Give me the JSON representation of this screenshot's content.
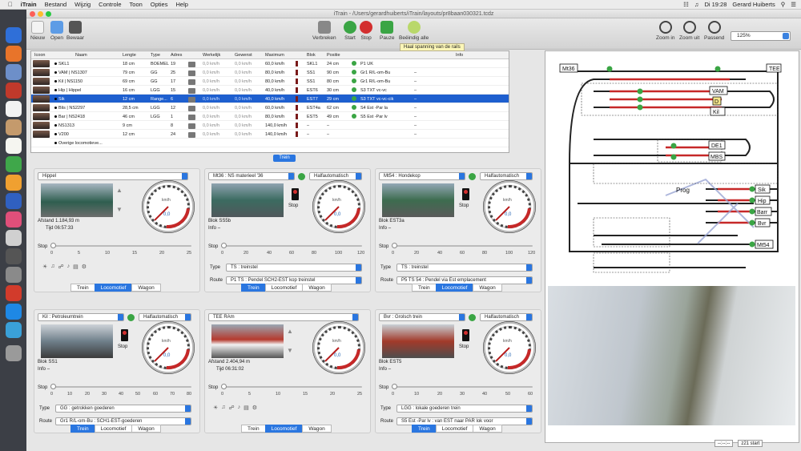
{
  "menubar": {
    "app": "iTrain",
    "items": [
      "Bestand",
      "Wijzig",
      "Controle",
      "Toon",
      "Opties",
      "Help"
    ],
    "clock": "Di 19:28",
    "user": "Gerard Huiberts"
  },
  "window": {
    "title": "iTrain - /Users/gerardhuiberts/iTrain/layouts/pr8baan030321.tcdz"
  },
  "toolbar": {
    "nieuw": "Nieuw",
    "open": "Open",
    "bewaar": "Bewaar",
    "verbreken": "Verbreken",
    "start": "Start",
    "stop": "Stop",
    "pauze": "Pauze",
    "beeindig": "Beëindig alle",
    "zoom_in": "Zoom in",
    "zoom_out": "Zoom uit",
    "passend": "Passend",
    "zoom_value": "125%",
    "tooltip": "Haal spanning van de rails"
  },
  "table": {
    "headers": [
      "Icoon",
      "Naam",
      "Lengte",
      "Type",
      "Adres",
      "Werkelijk",
      "Gewenst",
      "Maximum",
      "Blok",
      "Positie",
      "Info"
    ],
    "rows": [
      {
        "name": "SKL1",
        "length": "18 cm",
        "type": "BOEMEL",
        "addr": "19",
        "werk": "0,0 km/h",
        "gew": "0,0 km/h",
        "max": "60,0 km/h",
        "blok": "SKL1",
        "pos": "24 cm",
        "route": "P1 UK",
        "info": "",
        "sel": false
      },
      {
        "name": "VAM | NS1307",
        "length": "79 cm",
        "type": "GG",
        "addr": "25",
        "werk": "0,0 km/h",
        "gew": "0,0 km/h",
        "max": "80,0 km/h",
        "blok": "SS1",
        "pos": "90 cm",
        "route": "Gr1 R/L-om-Bu",
        "info": "–",
        "sel": false
      },
      {
        "name": "Kil | NS1150",
        "length": "69 cm",
        "type": "GG",
        "addr": "17",
        "werk": "0,0 km/h",
        "gew": "0,0 km/h",
        "max": "80,0 km/h",
        "blok": "SS1",
        "pos": "80 cm",
        "route": "Gr1 R/L-om-Bu",
        "info": "–",
        "sel": false
      },
      {
        "name": "Hip | Hippel",
        "length": "16 cm",
        "type": "LGG",
        "addr": "15",
        "werk": "0,0 km/h",
        "gew": "0,0 km/h",
        "max": "40,0 km/h",
        "blok": "EST6",
        "pos": "30 cm",
        "route": "S3 TXT vc-vc",
        "info": "–",
        "sel": false
      },
      {
        "name": "Sik",
        "length": "12 cm",
        "type": "Range...",
        "addr": "6",
        "werk": "0,0 km/h",
        "gew": "0,0 km/h",
        "max": "40,0 km/h",
        "blok": "EST7",
        "pos": "29 cm",
        "route": "S3 TXT vc-vc-cik",
        "info": "–",
        "sel": true
      },
      {
        "name": "Blis | NS2297",
        "length": "28,5 cm",
        "type": "LGG",
        "addr": "12",
        "werk": "0,0 km/h",
        "gew": "0,0 km/h",
        "max": "60,0 km/h",
        "blok": "EST4a",
        "pos": "62 cm",
        "route": "S4 Est -Par la",
        "info": "–",
        "sel": false
      },
      {
        "name": "Bar | NS2418",
        "length": "46 cm",
        "type": "LGG",
        "addr": "1",
        "werk": "0,0 km/h",
        "gew": "0,0 km/h",
        "max": "80,0 km/h",
        "blok": "EST5",
        "pos": "49 cm",
        "route": "S5 Est -Par lv",
        "info": "–",
        "sel": false
      },
      {
        "name": "NS1313",
        "length": "9 cm",
        "type": "",
        "addr": "8",
        "werk": "0,0 km/h",
        "gew": "0,0 km/h",
        "max": "140,0 km/h",
        "blok": "–",
        "pos": "–",
        "route": "",
        "info": "–",
        "sel": false
      },
      {
        "name": "V200",
        "length": "12 cm",
        "type": "",
        "addr": "24",
        "werk": "0,0 km/h",
        "gew": "0,0 km/h",
        "max": "140,0 km/h",
        "blok": "–",
        "pos": "–",
        "route": "",
        "info": "–",
        "sel": false
      },
      {
        "name": "Overige locomotieve...",
        "length": "",
        "type": "",
        "addr": "",
        "werk": "",
        "gew": "",
        "max": "",
        "blok": "",
        "pos": "",
        "route": "",
        "info": "",
        "sel": false
      }
    ]
  },
  "trein_tab": "Trein",
  "panels": [
    {
      "title": "Hippel",
      "mode": "",
      "afstand_label": "Afstand",
      "afstand": "1.184,93 m",
      "tijd_label": "Tijd",
      "tijd": "06:57:33",
      "blok": "",
      "info": "",
      "stop": "Stop",
      "scale": [
        "0",
        "5",
        "10",
        "15",
        "20",
        "25"
      ],
      "type": "",
      "route": "",
      "gauge_val": "0,0",
      "tabs": [
        "Trein",
        "Locomotief",
        "Wagon"
      ],
      "active": 1,
      "kmh": "km/h"
    },
    {
      "title": "Mt36 : NS materieel '36",
      "mode": "Halfautomatisch",
      "blok_label": "Blok",
      "blok": "SS5b",
      "info_label": "Info",
      "info": "–",
      "stop": "Stop",
      "scale": [
        "0",
        "20",
        "40",
        "60",
        "80",
        "100",
        "120"
      ],
      "type_label": "Type",
      "type": "TS : treinstel",
      "route_label": "Route",
      "route": "P1 TS : Pendel SCH2-EST kop treinstel",
      "gauge_val": "0,0",
      "tabs": [
        "Trein",
        "Locomotief",
        "Wagon"
      ],
      "active": 0,
      "kmh": "km/h"
    },
    {
      "title": "Mt54 : Hondekop",
      "mode": "Halfautomatisch",
      "blok_label": "Blok",
      "blok": "EST3a",
      "info_label": "Info",
      "info": "–",
      "stop": "Stop",
      "scale": [
        "0",
        "20",
        "40",
        "60",
        "80",
        "100",
        "120"
      ],
      "type_label": "Type",
      "type": "TS : treinstel",
      "route_label": "Route",
      "route": "P5 TS 54 : Pendel via Est emplacement",
      "gauge_val": "0,0",
      "tabs": [
        "Trein",
        "Locomotief",
        "Wagon"
      ],
      "active": 1,
      "kmh": "km/h"
    },
    {
      "title": "Kil : Petroleumtrein",
      "mode": "Halfautomatisch",
      "blok_label": "Blok",
      "blok": "SS1",
      "info_label": "Info",
      "info": "–",
      "stop": "Stop",
      "scale": [
        "0",
        "10",
        "20",
        "30",
        "40",
        "50",
        "60",
        "70",
        "80"
      ],
      "type_label": "Type",
      "type": "GG : getrokken goederen",
      "route_label": "Route",
      "route": "Gr1 R/L-om-Bu : SCH1-EST-goederen",
      "gauge_val": "0,0",
      "tabs": [
        "Trein",
        "Locomotief",
        "Wagon"
      ],
      "active": 0,
      "kmh": "km/h"
    },
    {
      "title": "TEE RAm",
      "mode": "",
      "afstand_label": "Afstand",
      "afstand": "2.404,94 m",
      "tijd_label": "Tijd",
      "tijd": "06:31:02",
      "stop": "Stop",
      "scale": [
        "0",
        "5",
        "10",
        "15",
        "20",
        "25"
      ],
      "gauge_val": "0,0",
      "tabs": [
        "Trein",
        "Locomotief",
        "Wagon"
      ],
      "active": 1,
      "kmh": "km/h"
    },
    {
      "title": "Bvr : Grolsch trein",
      "mode": "Halfautomatisch",
      "blok_label": "Blok",
      "blok": "EST5",
      "info_label": "Info",
      "info": "–",
      "stop": "Stop",
      "scale": [
        "0",
        "10",
        "20",
        "30",
        "40",
        "50",
        "60"
      ],
      "type_label": "Type",
      "type": "LGG : lokale goederen trein",
      "route_label": "Route",
      "route": "S5 Est -Par lv : van EST naar PAR lok voor",
      "gauge_val": "0,0",
      "tabs": [
        "Trein",
        "Locomotief",
        "Wagon"
      ],
      "active": 0,
      "kmh": "km/h"
    }
  ],
  "layout_labels": {
    "mt36": "Mt36",
    "tee": "TEE",
    "vam": "VAM",
    "d": "D",
    "kil": "Kil",
    "de1": "DE1",
    "mbs": "MBS",
    "prog": "Prog",
    "sik": "Sik",
    "hip": "Hip",
    "barr": "Barr",
    "bvr": "Bvr",
    "mt54": "Mt54"
  },
  "status": {
    "blank": "--:--:--",
    "z21": "z21 start"
  }
}
